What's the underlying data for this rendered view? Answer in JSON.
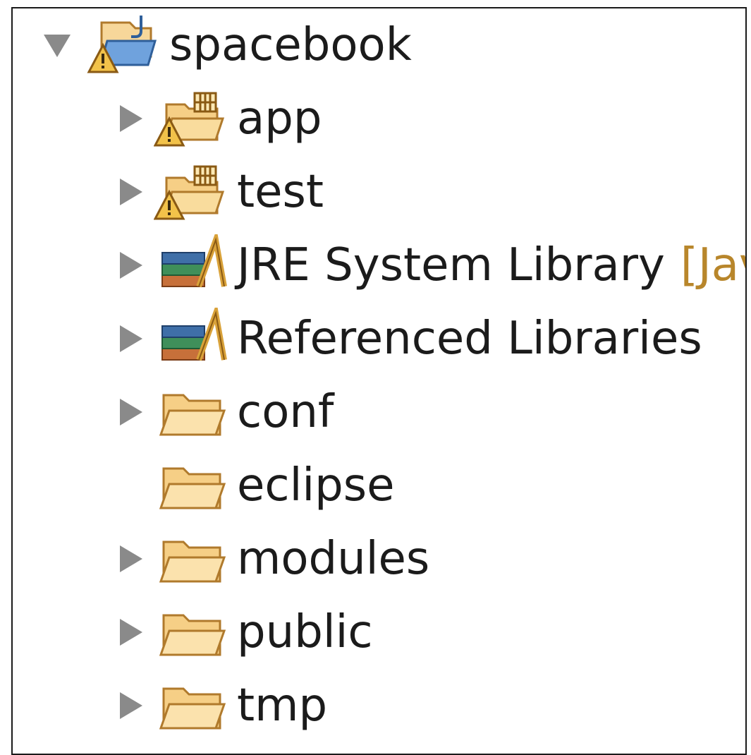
{
  "tree": {
    "root": {
      "label": "spacebook",
      "icon": "java-project-warning-icon",
      "expanded": true
    },
    "children": [
      {
        "label": "app",
        "icon": "source-folder-warning-icon",
        "has_children": true
      },
      {
        "label": "test",
        "icon": "source-folder-warning-icon",
        "has_children": true
      },
      {
        "label": "JRE System Library",
        "decoration": "[Jav",
        "icon": "library-icon",
        "has_children": true
      },
      {
        "label": "Referenced Libraries",
        "icon": "library-icon",
        "has_children": true
      },
      {
        "label": "conf",
        "icon": "folder-icon",
        "has_children": true
      },
      {
        "label": "eclipse",
        "icon": "folder-icon",
        "has_children": false
      },
      {
        "label": "modules",
        "icon": "folder-icon",
        "has_children": true
      },
      {
        "label": "public",
        "icon": "folder-icon",
        "has_children": true
      },
      {
        "label": "tmp",
        "icon": "folder-icon",
        "has_children": true
      }
    ]
  },
  "colors": {
    "border": "#1a1a1a",
    "text": "#1b1b1b",
    "decoration_text": "#b8862b",
    "twisty": "#8a8a8a",
    "folder_fill": "#f6cf86",
    "folder_stroke": "#b07a2c"
  }
}
